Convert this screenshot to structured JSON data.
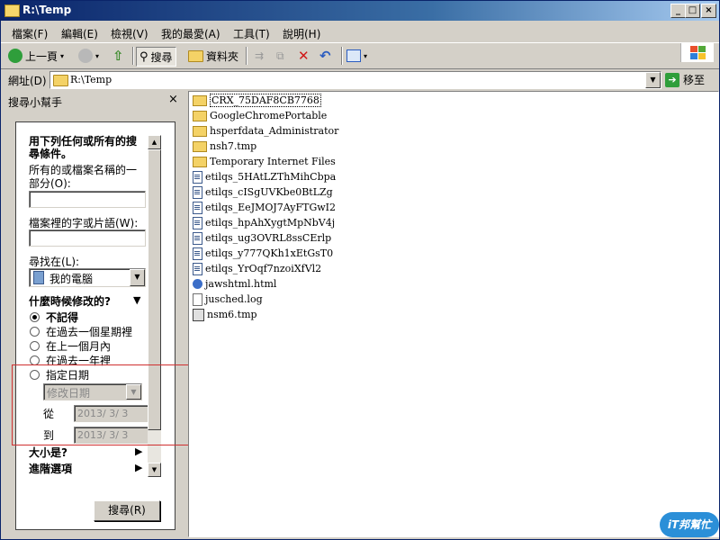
{
  "window": {
    "title": "R:\\Temp"
  },
  "menu": [
    "檔案(F)",
    "編輯(E)",
    "檢視(V)",
    "我的最愛(A)",
    "工具(T)",
    "說明(H)"
  ],
  "toolbar": {
    "back": "上一頁",
    "search": "搜尋",
    "folders": "資料夾"
  },
  "address": {
    "label": "網址(D)",
    "path": "R:\\Temp",
    "go": "移至"
  },
  "search_pane": {
    "title": "搜尋小幫手",
    "close": "×",
    "heading": "用下列任何或所有的搜尋條件。",
    "name_label": "所有的或檔案名稱的一部分(O):",
    "name_value": "",
    "phrase_label": "檔案裡的字或片語(W):",
    "phrase_value": "",
    "look_in_label": "尋找在(L):",
    "look_in_value": "我的電腦",
    "when_heading": "什麼時候修改的?",
    "when_options": [
      "不記得",
      "在過去一個星期裡",
      "在上一個月內",
      "在過去一年裡",
      "指定日期"
    ],
    "selected_index": 0,
    "date_type": "修改日期",
    "from_label": "從",
    "from_value": "2013/ 3/ 3",
    "to_label": "到",
    "to_value": "2013/ 3/ 3",
    "size_heading": "大小是?",
    "advanced_heading": "進階選項",
    "search_button": "搜尋(R)"
  },
  "files": [
    {
      "name": "CRX_75DAF8CB7768",
      "type": "folder"
    },
    {
      "name": "GoogleChromePortable",
      "type": "folder"
    },
    {
      "name": "hsperfdata_Administrator",
      "type": "folder"
    },
    {
      "name": "nsh7.tmp",
      "type": "folder"
    },
    {
      "name": "Temporary Internet Files",
      "type": "folder"
    },
    {
      "name": "etilqs_5HAtLZThMihCbpa",
      "type": "file"
    },
    {
      "name": "etilqs_cISgUVKbe0BtLZg",
      "type": "file"
    },
    {
      "name": "etilqs_EeJMOJ7AyFTGwI2",
      "type": "file"
    },
    {
      "name": "etilqs_hpAhXygtMpNbV4j",
      "type": "file"
    },
    {
      "name": "etilqs_ug3OVRL8ssCErlp",
      "type": "file"
    },
    {
      "name": "etilqs_y777QKh1xEtGsT0",
      "type": "file"
    },
    {
      "name": "etilqs_YrOqf7nzoiXfVl2",
      "type": "file"
    },
    {
      "name": "jawshtml.html",
      "type": "html"
    },
    {
      "name": "jusched.log",
      "type": "log"
    },
    {
      "name": "nsm6.tmp",
      "type": "nsm"
    }
  ],
  "watermark": "iT邦幫忙"
}
